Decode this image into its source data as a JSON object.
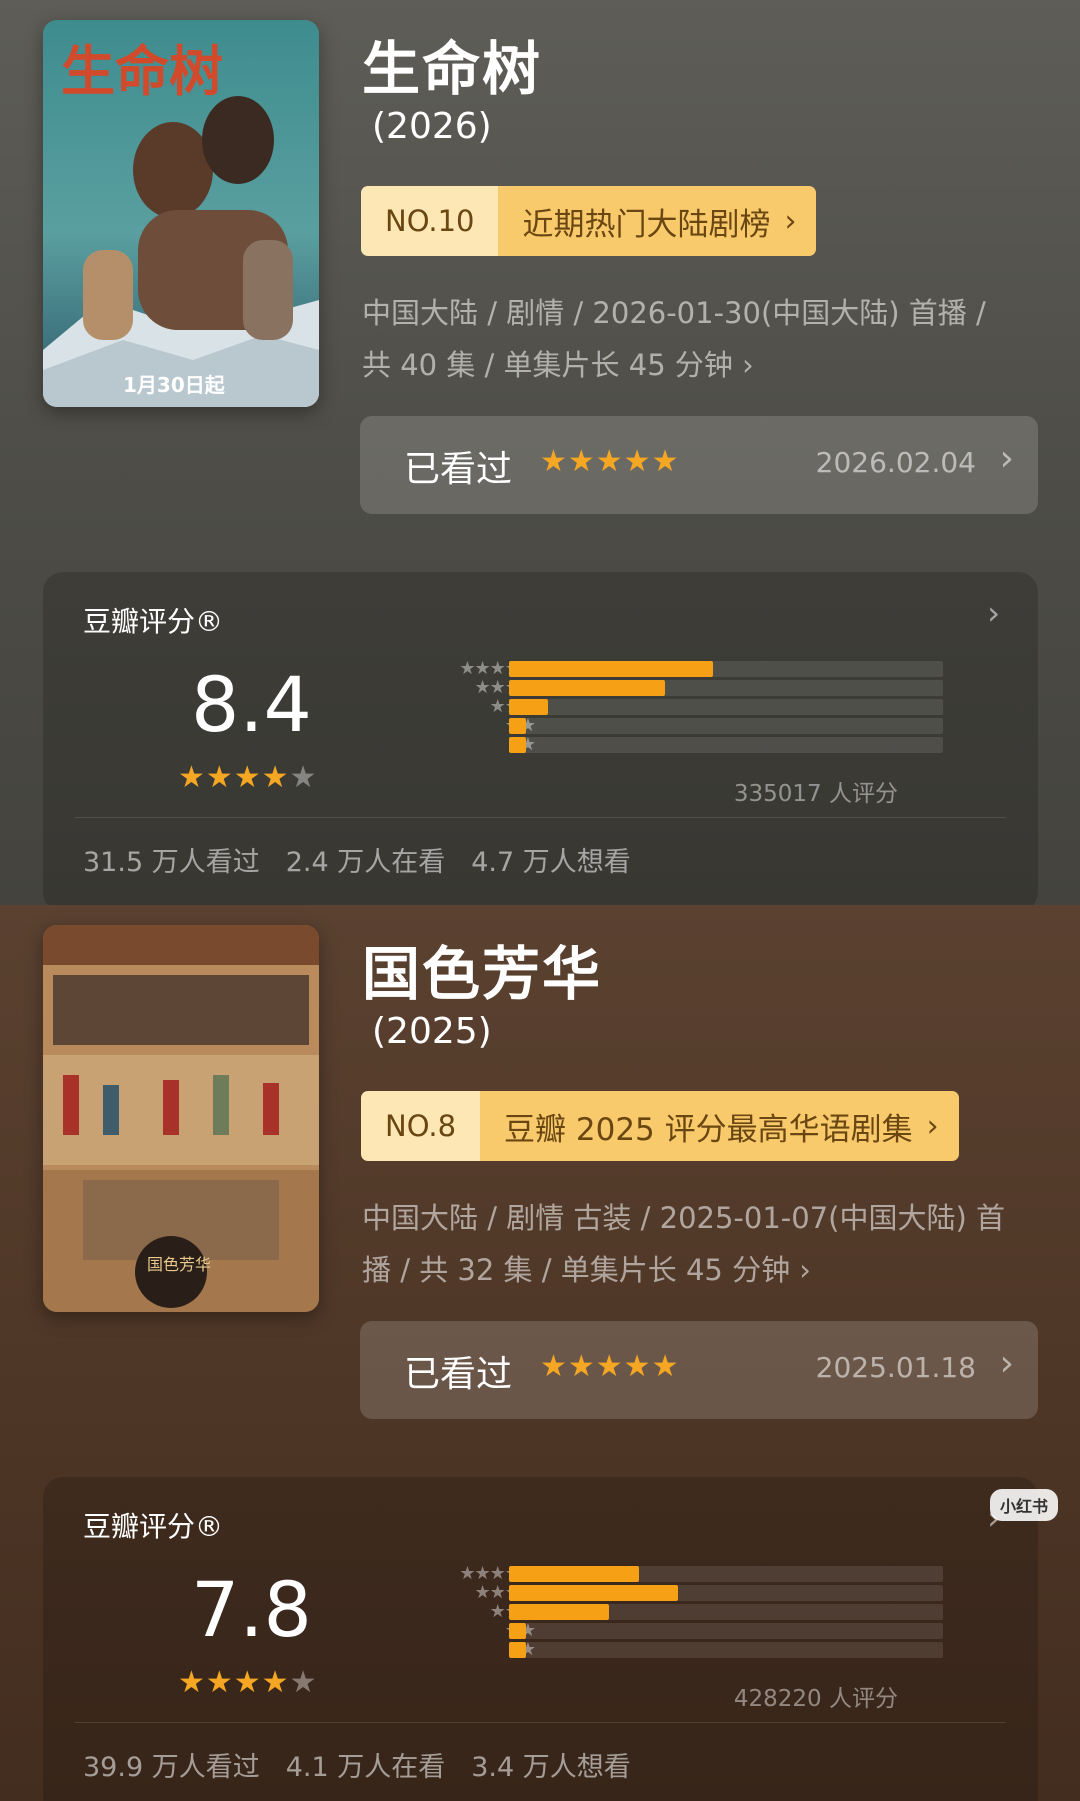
{
  "shows": [
    {
      "title": "生命树",
      "year": "(2026)",
      "rank_no": "NO.10",
      "rank_list": "近期热门大陆剧榜",
      "meta_line1": "中国大陆 / 剧情 / 2026-01-30(中国大陆) 首播 /",
      "meta_line2": "共 40 集 / 单集片长 45 分钟 ›",
      "watched_label": "已看过",
      "watched_stars": "★★★★★",
      "watched_date": "2026.02.04",
      "poster_title": "生命树",
      "poster_date": "1月30日起",
      "rating_title": "豆瓣评分®",
      "score": "8.4",
      "score_stars_on": "★★★★",
      "score_stars_off": "★",
      "distribution": [
        0.47,
        0.36,
        0.09,
        0.04,
        0.04
      ],
      "rating_count": "335017 人评分",
      "stat_watched": "31.5 万人看过",
      "stat_watching": "2.4 万人在看",
      "stat_want": "4.7 万人想看"
    },
    {
      "title": "国色芳华",
      "year": "(2025)",
      "rank_no": "NO.8",
      "rank_list": "豆瓣 2025 评分最高华语剧集",
      "meta_line1": "中国大陆 / 剧情 古装 / 2025-01-07(中国大陆) 首",
      "meta_line2": "播 / 共 32 集 / 单集片长 45 分钟 ›",
      "watched_label": "已看过",
      "watched_stars": "★★★★★",
      "watched_date": "2025.01.18",
      "poster_title": "国色芳华",
      "rating_title": "豆瓣评分®",
      "score": "7.8",
      "score_stars_on": "★★★★",
      "score_stars_off": "★",
      "distribution": [
        0.3,
        0.39,
        0.23,
        0.04,
        0.04
      ],
      "rating_count": "428220 人评分",
      "stat_watched": "39.9 万人看过",
      "stat_watching": "4.1 万人在看",
      "stat_want": "3.4 万人想看"
    }
  ],
  "dist_labels": [
    "★★★★★",
    "★★★★",
    "★★★",
    "★★",
    "★"
  ],
  "watermark": "小红书",
  "colors": {
    "accent_star": "#f5a623",
    "bar": "#f5a015",
    "rank_light": "#fde7b4",
    "rank_dark": "#f9ca6c"
  }
}
